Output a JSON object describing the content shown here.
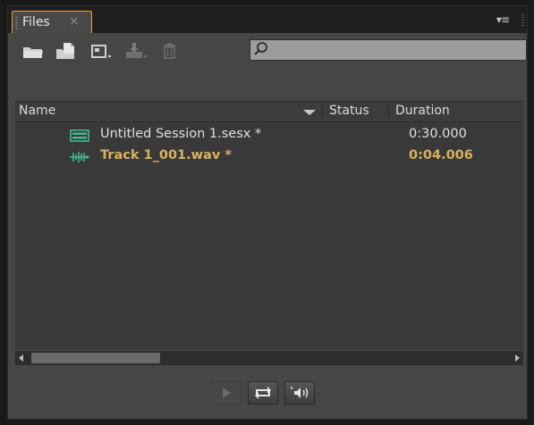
{
  "tab": {
    "label": "Files",
    "close": "×"
  },
  "panel_menu_glyph": "▾≡",
  "search": {
    "value": "",
    "placeholder": ""
  },
  "columns": {
    "name": "Name",
    "status": "Status",
    "duration": "Duration"
  },
  "files": [
    {
      "name": "Untitled Session 1.sesx *",
      "duration": "0:30.000",
      "type": "session",
      "color": "#e0e0e0"
    },
    {
      "name": "Track 1_001.wav *",
      "duration": "0:04.006",
      "type": "audio",
      "color": "#d9b25c"
    }
  ],
  "colors": {
    "accent": "#e8a534",
    "icon_green": "#3fbf8f",
    "selected_text": "#d9b25c"
  },
  "toolbar_icons": [
    "open-folder-icon",
    "import-file-icon",
    "new-file-icon",
    "insert-into-multitrack-icon",
    "delete-icon"
  ],
  "transport_icons": [
    "play-icon",
    "loop-icon",
    "auto-play-speaker-icon"
  ]
}
